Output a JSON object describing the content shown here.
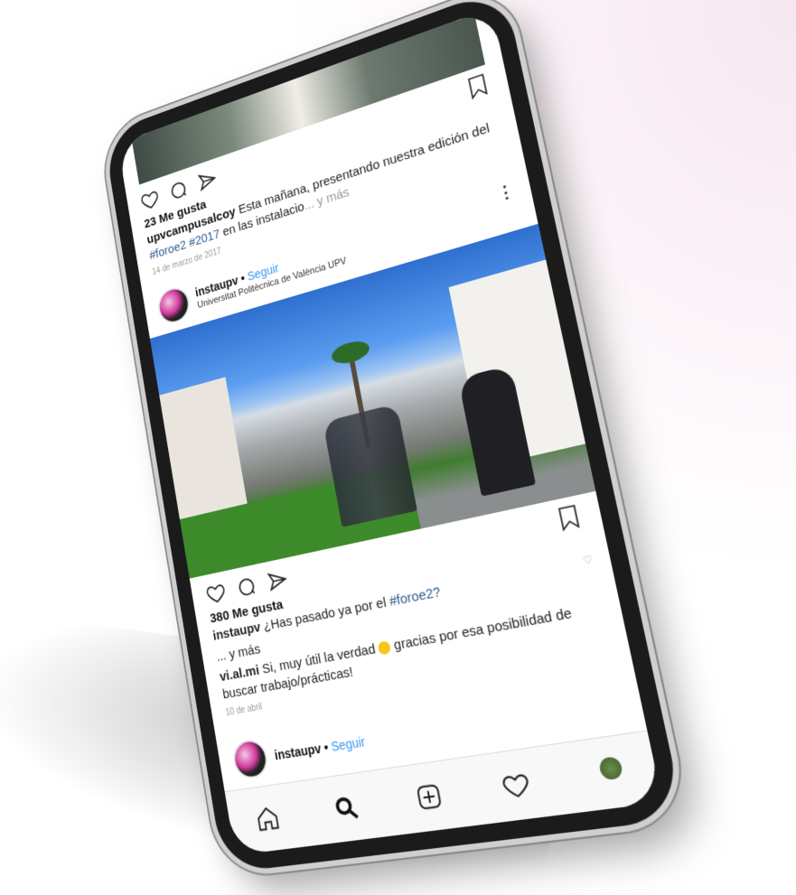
{
  "post1": {
    "likes": "23 Me gusta",
    "username": "upvcampusalcoy",
    "caption": "Esta mañana, presentando nuestra edición del",
    "hashtags": "#foroe2 #2017",
    "caption_tail": "en las instalacio",
    "more": "... y más",
    "date": "14 de marzo de 2017"
  },
  "post2": {
    "username": "instaupv",
    "separator": " • ",
    "follow": "Seguir",
    "location": "Universitat Politècnica de València UPV",
    "likes": "380 Me gusta",
    "caption_user": "instaupv",
    "caption": "¿Has pasado ya por el",
    "hashtag": "#foroe2?",
    "more": "... y más",
    "comment_user": "vi.al.mi",
    "comment_a": "Si, muy útil la verdad",
    "comment_b": "gracias por esa posibilidad de buscar trabajo/prácticas!",
    "date": "10 de abril",
    "options": "⋮"
  },
  "post3": {
    "username": "instaupv",
    "separator": " • ",
    "follow": "Seguir"
  },
  "tabbar": {
    "icons": [
      "home-icon",
      "search-icon",
      "add-icon",
      "heart-icon",
      "profile-icon"
    ]
  },
  "colors": {
    "link": "#3897f0",
    "hashtag": "#2e5d8f",
    "device": "#1b1b1b"
  }
}
